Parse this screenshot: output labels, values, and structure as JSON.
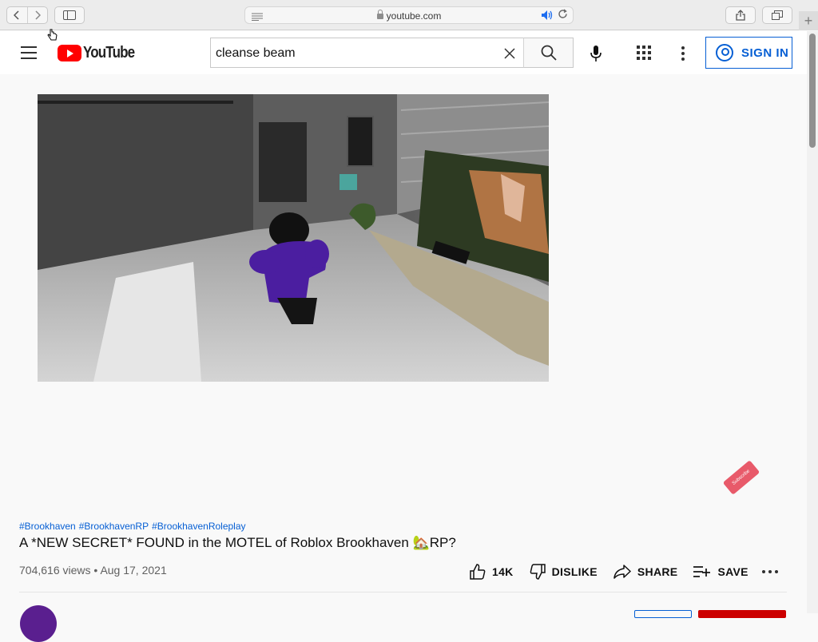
{
  "browser": {
    "url": "youtube.com",
    "back_icon": "chevron-left-icon",
    "forward_icon": "chevron-right-icon"
  },
  "header": {
    "logo_text": "YouTube",
    "search_value": "cleanse beam",
    "signin_label": "SIGN IN"
  },
  "video": {
    "hashtags": [
      "#Brookhaven",
      "#BrookhavenRP",
      "#BrookhavenRoleplay"
    ],
    "title": "A *NEW SECRET* FOUND in the MOTEL of Roblox Brookhaven 🏡RP?",
    "views": "704,616 views",
    "separator": "•",
    "date": "Aug 17, 2021",
    "watermark_text": "Subscribe"
  },
  "actions": {
    "like_count": "14K",
    "dislike_label": "DISLIKE",
    "share_label": "SHARE",
    "save_label": "SAVE"
  },
  "colors": {
    "brand_red": "#ff0000",
    "link_blue": "#065fd4"
  }
}
